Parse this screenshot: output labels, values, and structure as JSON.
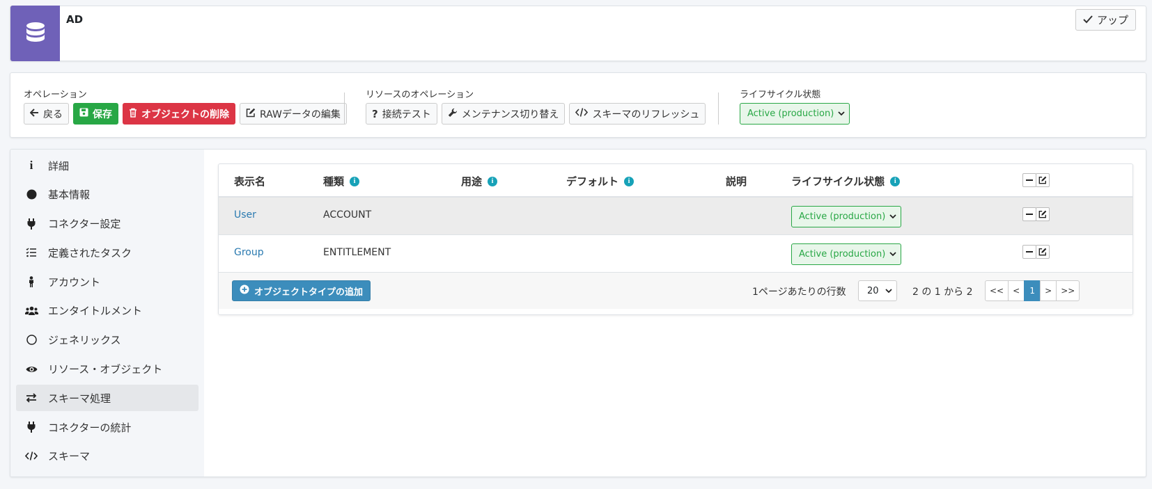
{
  "header": {
    "title": "AD",
    "up_label": "アップ"
  },
  "operations": {
    "label": "オペレーション",
    "back": "戻る",
    "save": "保存",
    "delete": "オブジェクトの削除",
    "edit_raw": "RAWデータの編集"
  },
  "resource_ops": {
    "label": "リソースのオペレーション",
    "test": "接続テスト",
    "maintenance": "メンテナンス切り替え",
    "refresh": "スキーマのリフレッシュ"
  },
  "lifecycle": {
    "label": "ライフサイクル状態",
    "value": "Active (production)"
  },
  "sidebar": {
    "items": [
      {
        "label": "詳細"
      },
      {
        "label": "基本情報"
      },
      {
        "label": "コネクター設定"
      },
      {
        "label": "定義されたタスク"
      },
      {
        "label": "アカウント"
      },
      {
        "label": "エンタイトルメント"
      },
      {
        "label": "ジェネリックス"
      },
      {
        "label": "リソース・オブジェクト"
      },
      {
        "label": "スキーマ処理"
      },
      {
        "label": "コネクターの統計"
      },
      {
        "label": "スキーマ"
      }
    ]
  },
  "table": {
    "headers": {
      "name": "表示名",
      "kind": "種類",
      "intent": "用途",
      "default": "デフォルト",
      "description": "説明",
      "lifecycle": "ライフサイクル状態"
    },
    "rows": [
      {
        "name": "User",
        "kind": "ACCOUNT",
        "intent": "",
        "default": "",
        "description": "",
        "lifecycle": "Active (production)"
      },
      {
        "name": "Group",
        "kind": "ENTITLEMENT",
        "intent": "",
        "default": "",
        "description": "",
        "lifecycle": "Active (production)"
      }
    ],
    "add_button": "オブジェクトタイプの追加",
    "rows_per_page_label": "1ページあたりの行数",
    "page_size": "20",
    "range_label": "2 の 1 から 2",
    "pager": {
      "first": "<<",
      "prev": "<",
      "current": "1",
      "next": ">",
      "last": ">>"
    }
  },
  "colors": {
    "logo_bg": "#6f61b8",
    "success": "#28a745",
    "danger": "#dc3545",
    "primary": "#3c8dbc",
    "info": "#17a2b8",
    "link": "#2a7ab0"
  },
  "icons": [
    "database-icon",
    "check-icon",
    "arrow-left-icon",
    "save-icon",
    "trash-icon",
    "edit-icon",
    "question-icon",
    "wrench-icon",
    "code-icon",
    "chevron-down-icon",
    "info-icon",
    "circle-solid-icon",
    "plug-icon",
    "tasks-icon",
    "person-icon",
    "users-icon",
    "circle-outline-icon",
    "eye-icon",
    "exchange-icon",
    "minus-icon",
    "plus-circle-icon"
  ]
}
